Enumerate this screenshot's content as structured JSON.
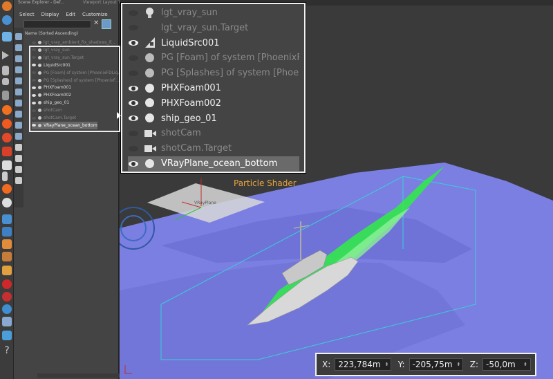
{
  "explorer": {
    "title": "Scene Explorer - Def...",
    "tab2": "Viewport Layout T...",
    "menu": [
      "Select",
      "Display",
      "Edit",
      "Customize"
    ],
    "column_header": "Name (Sorted Ascending)",
    "items": [
      {
        "label": "lgt_vray_ambient_fix_shadows_if...",
        "dim": true
      },
      {
        "label": "lgt_vray_sun",
        "dim": true
      },
      {
        "label": "lgt_vray_sun.Target",
        "dim": true
      },
      {
        "label": "LiquidSrc001",
        "dim": false
      },
      {
        "label": "PG [Foam] of system [PhoenixFDLiq...",
        "dim": true
      },
      {
        "label": "PG [Splashes] of system [PhoenixF...",
        "dim": true
      },
      {
        "label": "PHXFoam001",
        "dim": false
      },
      {
        "label": "PHXFoam002",
        "dim": false
      },
      {
        "label": "ship_geo_01",
        "dim": false
      },
      {
        "label": "shotCam",
        "dim": true
      },
      {
        "label": "shotCam.Target",
        "dim": true
      },
      {
        "label": "VRayPlane_ocean_bottom",
        "dim": false,
        "selected": true
      }
    ]
  },
  "zoom_list": [
    {
      "label": "lgt_vray_sun",
      "icon": "bulb-icon",
      "visible": false,
      "dim": true
    },
    {
      "label": "lgt_vray_sun.Target",
      "icon": "none",
      "visible": false,
      "dim": true
    },
    {
      "label": "LiquidSrc001",
      "icon": "liquid-source-icon",
      "visible": true,
      "dim": false
    },
    {
      "label": "PG [Foam] of system [PhoenixFDLiq",
      "icon": "circle-icon",
      "visible": false,
      "dim": true
    },
    {
      "label": "PG [Splashes] of system [PhoenixF",
      "icon": "circle-icon",
      "visible": false,
      "dim": true
    },
    {
      "label": "PHXFoam001",
      "icon": "circle-icon",
      "visible": true,
      "dim": false
    },
    {
      "label": "PHXFoam002",
      "icon": "circle-icon",
      "visible": true,
      "dim": false
    },
    {
      "label": "ship_geo_01",
      "icon": "circle-icon",
      "visible": true,
      "dim": false
    },
    {
      "label": "shotCam",
      "icon": "camera-icon",
      "visible": false,
      "dim": true
    },
    {
      "label": "shotCam.Target",
      "icon": "camera-icon",
      "visible": false,
      "dim": true
    },
    {
      "label": "VRayPlane_ocean_bottom",
      "icon": "circle-icon",
      "visible": true,
      "dim": false,
      "selected": true
    }
  ],
  "viewport": {
    "particle_shader_label": "Particle Shader",
    "vray_plane_label": "VRayPlane"
  },
  "coords": {
    "x_label": "X:",
    "x_value": "223,784m",
    "y_label": "Y:",
    "y_value": "-205,75m",
    "z_label": "Z:",
    "z_value": "-50,0m"
  },
  "colors": {
    "ocean": "#7a7ee0",
    "foam": "#2fe84a",
    "highlight_border": "#f2f2f2",
    "particle_shader": "#e8a53c"
  }
}
